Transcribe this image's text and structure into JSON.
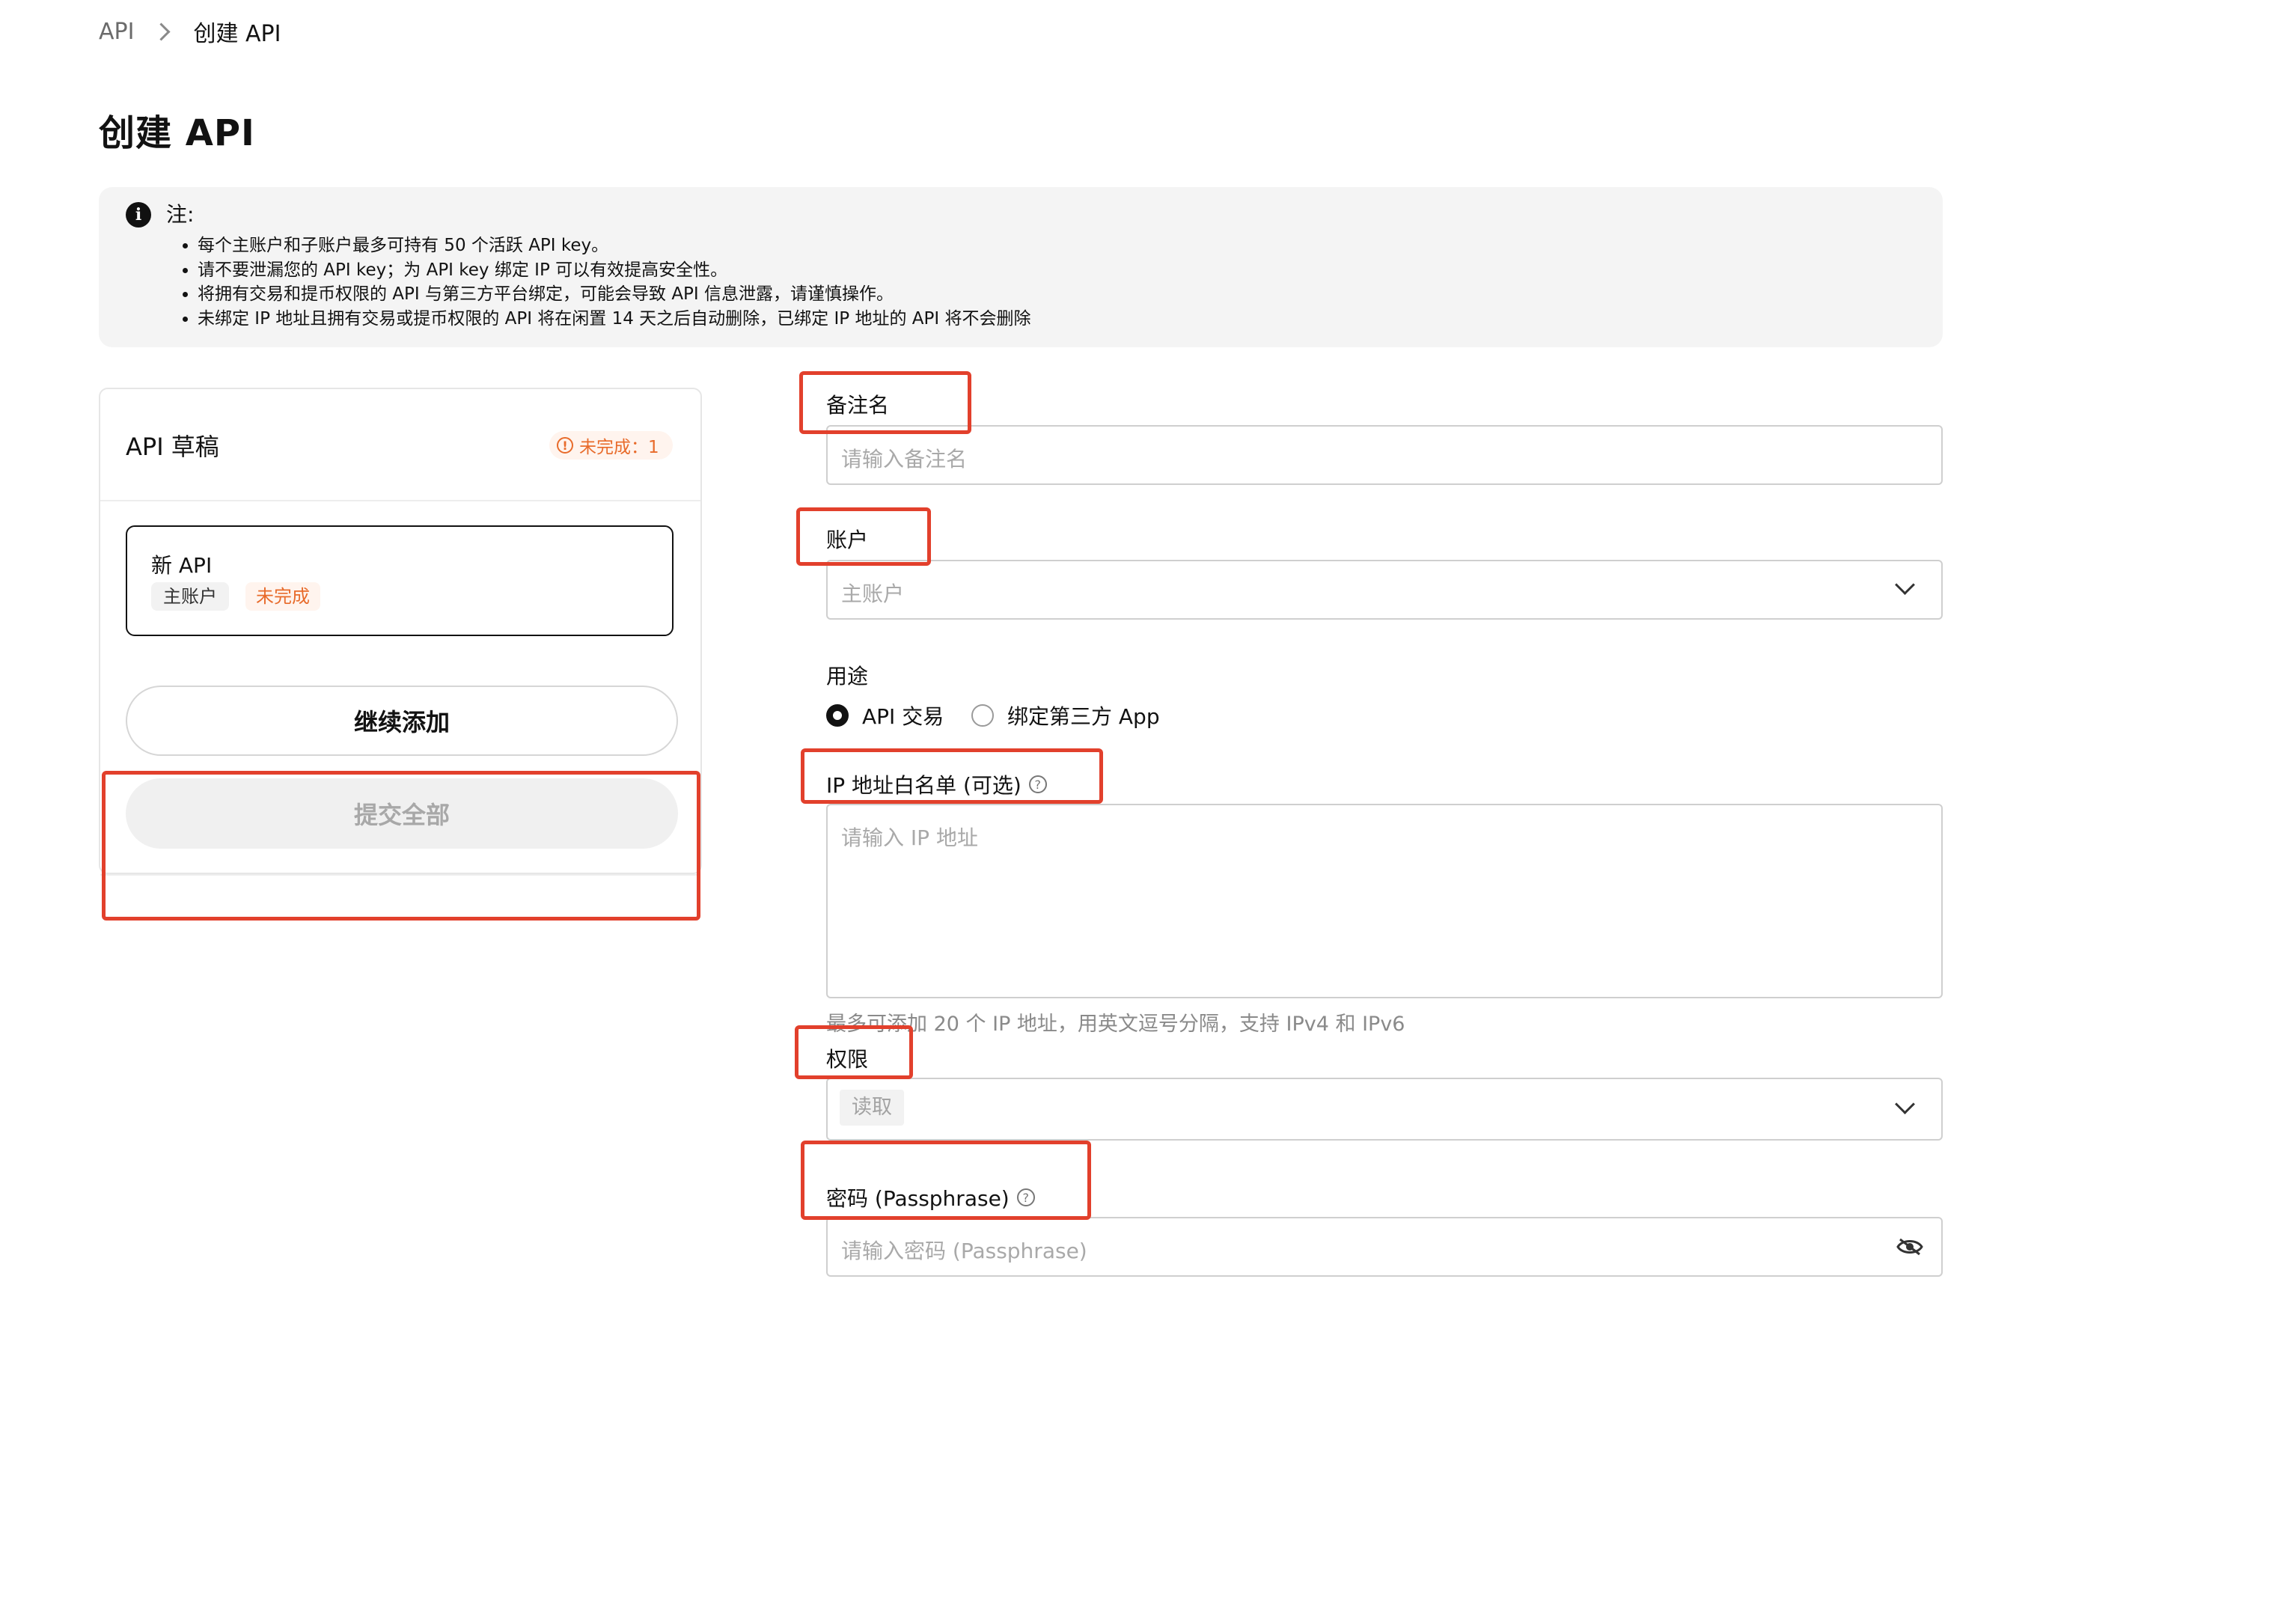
{
  "breadcrumb": {
    "parent": "API",
    "current": "创建 API"
  },
  "page": {
    "title": "创建 API"
  },
  "notice": {
    "title": "注:",
    "items": [
      "每个主账户和子账户最多可持有 50 个活跃 API key。",
      "请不要泄漏您的 API key；为 API key 绑定 IP 可以有效提高安全性。",
      "将拥有交易和提币权限的 API 与第三方平台绑定，可能会导致 API 信息泄露，请谨慎操作。",
      "未绑定 IP 地址且拥有交易或提币权限的 API 将在闲置 14 天之后自动删除，已绑定 IP 地址的 API 将不会删除"
    ]
  },
  "drafts": {
    "title": "API 草稿",
    "incomplete_badge": "未完成：1",
    "card": {
      "name": "新 API",
      "account_tag": "主账户",
      "status_tag": "未完成"
    },
    "add_button": "继续添加",
    "submit_button": "提交全部"
  },
  "form": {
    "remark": {
      "label": "备注名",
      "placeholder": "请输入备注名"
    },
    "account": {
      "label": "账户",
      "value": "主账户"
    },
    "purpose": {
      "label": "用途",
      "options": [
        {
          "label": "API 交易",
          "selected": true
        },
        {
          "label": "绑定第三方 App",
          "selected": false
        }
      ]
    },
    "ip_whitelist": {
      "label": "IP 地址白名单 (可选)",
      "placeholder": "请输入 IP 地址",
      "hint": "最多可添加 20 个 IP 地址，用英文逗号分隔，支持 IPv4 和 IPv6"
    },
    "permission": {
      "label": "权限",
      "chip": "读取"
    },
    "passphrase": {
      "label": "密码 (Passphrase)",
      "placeholder": "请输入密码 (Passphrase)"
    }
  },
  "icons": {
    "info": "info-icon",
    "help": "help-circle-icon",
    "chevron": "chevron-down-icon",
    "eye": "eye-off-icon",
    "warning": "warning-circle-icon"
  },
  "colors": {
    "accent_orange": "#e86b2b",
    "annotation_red": "#e2402c",
    "text_primary": "#121212",
    "placeholder": "#a9a9a9"
  }
}
